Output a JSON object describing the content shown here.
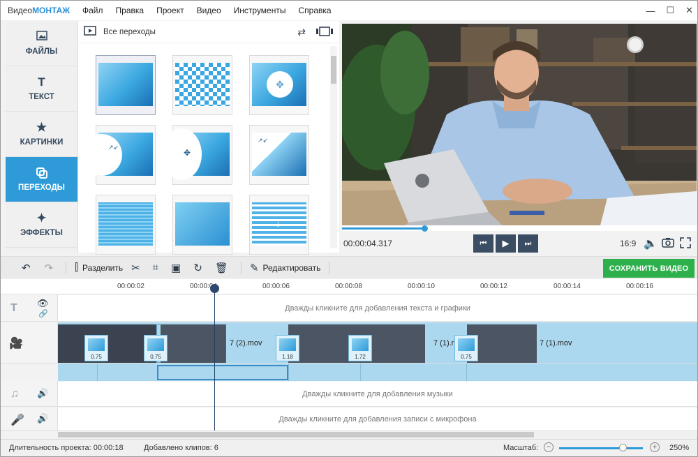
{
  "titlebar": {
    "logo_a": "Видео",
    "logo_b": "МОНТАЖ",
    "minimize": "—",
    "maximize": "☐",
    "close": "✕"
  },
  "menu": [
    "Файл",
    "Правка",
    "Проект",
    "Видео",
    "Инструменты",
    "Справка"
  ],
  "categories": [
    {
      "label": "ФАЙЛЫ",
      "icon": "image-icon"
    },
    {
      "label": "ТЕКСТ",
      "icon": "text-icon"
    },
    {
      "label": "КАРТИНКИ",
      "icon": "star-icon"
    },
    {
      "label": "ПЕРЕХОДЫ",
      "icon": "transitions-icon"
    },
    {
      "label": "ЭФФЕКТЫ",
      "icon": "magic-wand-icon"
    }
  ],
  "transitions": {
    "header": "Все переходы",
    "count": 9
  },
  "player": {
    "timecode": "00:00:04.317",
    "ratio": "16:9",
    "progress": 0.234
  },
  "toolbar": {
    "split": "Разделить",
    "edit": "Редактировать",
    "save": "СОХРАНИТЬ ВИДЕО"
  },
  "ruler": [
    "00:00:02",
    "00:00:04",
    "00:00:06",
    "00:00:08",
    "00:00:10",
    "00:00:12",
    "00:00:14",
    "00:00:16"
  ],
  "tracks": {
    "text_hint": "Дважды кликните для добавления текста и графики",
    "music_hint": "Дважды кликните для добавления музыки",
    "mic_hint": "Дважды кликните для добавления записи с микрофона"
  },
  "clips": {
    "label_a": "7 (2).mov",
    "label_b": "7 (1).r",
    "label_c": "7 (1).mov",
    "t1": "0.75",
    "t2": "0.75",
    "t3": "1.18",
    "t4": "1.72",
    "t5": "0.75"
  },
  "status": {
    "duration": "Длительность проекта:  00:00:18",
    "clips": "Добавлено клипов: 6",
    "scale": "Масштаб:",
    "zoom": "250%"
  },
  "colors": {
    "accent": "#2e9bd8",
    "save": "#2db04c",
    "dark": "#34495e"
  }
}
